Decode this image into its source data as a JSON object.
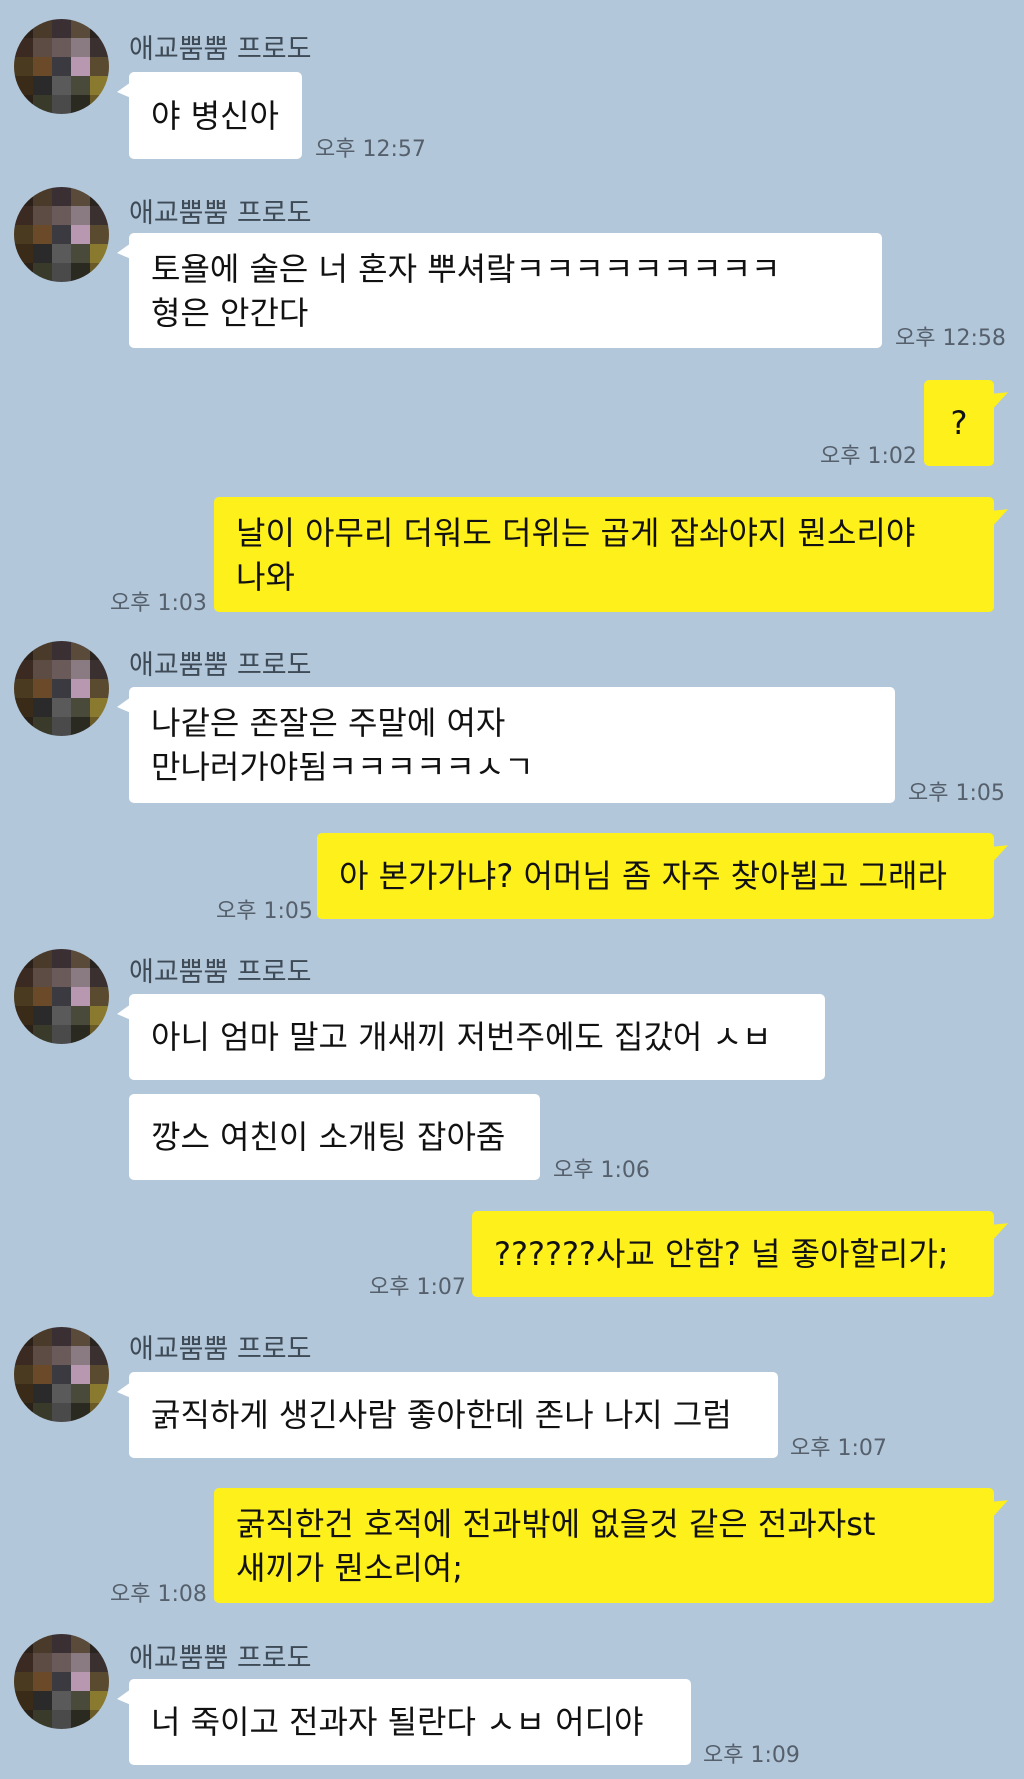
{
  "sender_name": "애교뿜뿜 프로도",
  "messages": [
    {
      "type": "in",
      "text": "야 병신아",
      "time": "오후 12:57"
    },
    {
      "type": "in",
      "text": "토욜에 술은 너 혼자 뿌셔랔ㅋㅋㅋㅋㅋㅋㅋㅋㅋ\n형은 안간다",
      "time": "오후 12:58"
    },
    {
      "type": "out",
      "text": "?",
      "time": "오후 1:02"
    },
    {
      "type": "out",
      "text": "날이 아무리 더워도 더위는 곱게 잡솨야지 뭔소리야\n나와",
      "time": "오후 1:03"
    },
    {
      "type": "in",
      "text": "나같은 존잘은 주말에 여자\n만나러가야됨ㅋㅋㅋㅋㅋㅅㄱ",
      "time": "오후 1:05"
    },
    {
      "type": "out",
      "text": "아 본가가냐? 어머님 좀 자주 찾아뵙고 그래라",
      "time": "오후 1:05"
    },
    {
      "type": "in",
      "text": "아니 엄마 말고 개새끼 저번주에도 집갔어 ㅅㅂ",
      "time": ""
    },
    {
      "type": "in",
      "text": "깡스 여친이 소개팅 잡아줌",
      "time": "오후 1:06"
    },
    {
      "type": "out",
      "text": "??????사교 안함? 널 좋아할리가;",
      "time": "오후 1:07"
    },
    {
      "type": "in",
      "text": "굵직하게 생긴사람 좋아한데 존나 나지 그럼",
      "time": "오후 1:07"
    },
    {
      "type": "out",
      "text": "굵직한건 호적에 전과밖에 없을것 같은 전과자st\n새끼가 뭔소리여;",
      "time": "오후 1:08"
    },
    {
      "type": "in",
      "text": "너 죽이고 전과자 될란다 ㅅㅂ 어디야",
      "time": "오후 1:09"
    }
  ],
  "colors": {
    "background": "#b3c7da",
    "incoming_bubble": "#ffffff",
    "outgoing_bubble": "#fef01b"
  },
  "avatar_icon": "pixelated-profile-avatar-icon"
}
